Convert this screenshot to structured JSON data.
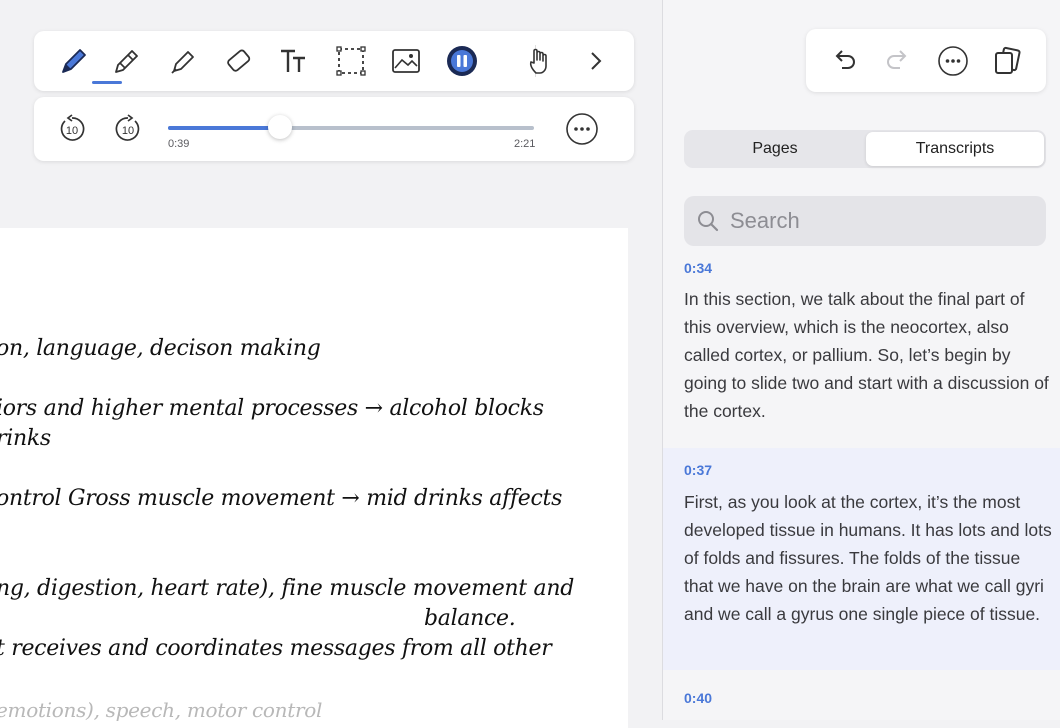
{
  "toolbar": {
    "tools": [
      {
        "name": "pen-tool",
        "icon": "pen-icon",
        "selected": true
      },
      {
        "name": "pencil-tool",
        "icon": "pencil-icon"
      },
      {
        "name": "highlighter-tool",
        "icon": "highlighter-icon"
      },
      {
        "name": "eraser-tool",
        "icon": "eraser-icon"
      },
      {
        "name": "text-tool",
        "icon": "text-icon"
      },
      {
        "name": "lasso-tool",
        "icon": "lasso-icon"
      },
      {
        "name": "image-tool",
        "icon": "image-icon"
      },
      {
        "name": "record-pause-tool",
        "icon": "pause-icon"
      },
      {
        "name": "hand-tool",
        "icon": "hand-icon"
      },
      {
        "name": "more-tools",
        "icon": "chevron-right-icon"
      }
    ],
    "accent": "#4a78d8"
  },
  "playback": {
    "current_time": "0:39",
    "total_time": "2:21",
    "progress": 0.307,
    "skip_back_label": "10",
    "skip_forward_label": "10"
  },
  "header_actions": [
    "undo-icon",
    "redo-icon",
    "more-icon",
    "pages-icon"
  ],
  "tabs": {
    "pages": "Pages",
    "transcripts": "Transcripts",
    "active": "transcripts"
  },
  "search": {
    "placeholder": "Search"
  },
  "transcript": [
    {
      "time": "0:34",
      "text": "In this section, we talk about the final part of this overview, which is the neocortex, also called cortex, or pallium. So, let’s begin by going to slide two and start with a discussion of the cortex."
    },
    {
      "time": "0:37",
      "text": "First, as you look at the cortex, it’s the most developed tissue in humans. It has lots and lots of folds and fissures. The folds of the tissue that we have on the brain are what we call gyri and we call a gyrus one single piece of tissue.",
      "highlighted": true
    },
    {
      "time": "0:40",
      "text": ""
    }
  ],
  "notes": {
    "lines": [
      "on, language, decison making",
      "iors and higher mental processes → alcohol blocks",
      "rinks",
      "ontrol Gross muscle  movement → mid drinks affects",
      "ng, digestion, heart rate), fine muscle  movement  and",
      "balance.",
      "t receives and coordinates messages from all other",
      "emotions), speech, motor control"
    ]
  }
}
